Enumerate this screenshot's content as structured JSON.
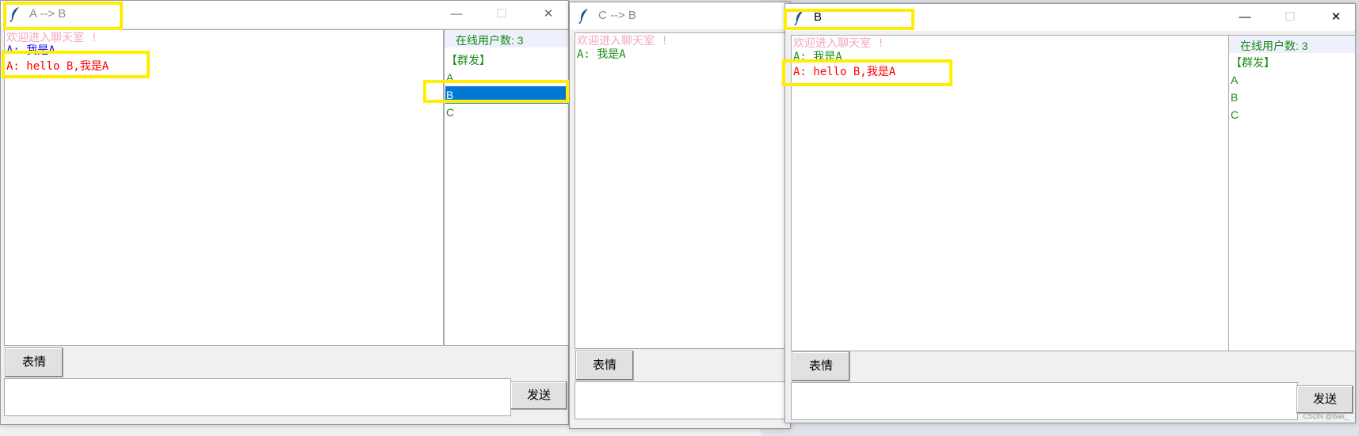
{
  "windows": {
    "a": {
      "title": "A  -->  B",
      "messages": [
        {
          "text": "欢迎进入聊天室 !",
          "color": "#f0a8bc"
        },
        {
          "text": "A: 我是A",
          "color": "#0000ff"
        },
        {
          "text": "A: hello B,我是A",
          "color": "#ff0000"
        }
      ],
      "online_label": "在线用户数: 3",
      "users": [
        "【群发】",
        "A",
        "B",
        "C"
      ],
      "selected_user": "B",
      "emoji_button": "表情",
      "send_button": "发送",
      "input_value": ""
    },
    "c": {
      "title": "C  -->  B",
      "messages": [
        {
          "text": "欢迎进入聊天室 !",
          "color": "#f0a8bc"
        },
        {
          "text": "A: 我是A",
          "color": "#1a8a1a"
        }
      ],
      "emoji_button": "表情",
      "input_value": ""
    },
    "b": {
      "title": "B",
      "messages": [
        {
          "text": "欢迎进入聊天室 !",
          "color": "#f0a8bc"
        },
        {
          "text": "A: 我是A",
          "color": "#1a8a1a"
        },
        {
          "text": "A: hello B,我是A",
          "color": "#ff0000"
        }
      ],
      "online_label": "在线用户数: 3",
      "users": [
        "【群发】",
        "A",
        "B",
        "C"
      ],
      "emoji_button": "表情",
      "send_button": "发送",
      "input_value": ""
    }
  },
  "controls": {
    "minimize": "—",
    "maximize": "☐",
    "close": "✕"
  },
  "icons": {
    "app": "feather-icon"
  },
  "highlight_color": "#ffee00",
  "watermark": "CSDN @Bak_"
}
